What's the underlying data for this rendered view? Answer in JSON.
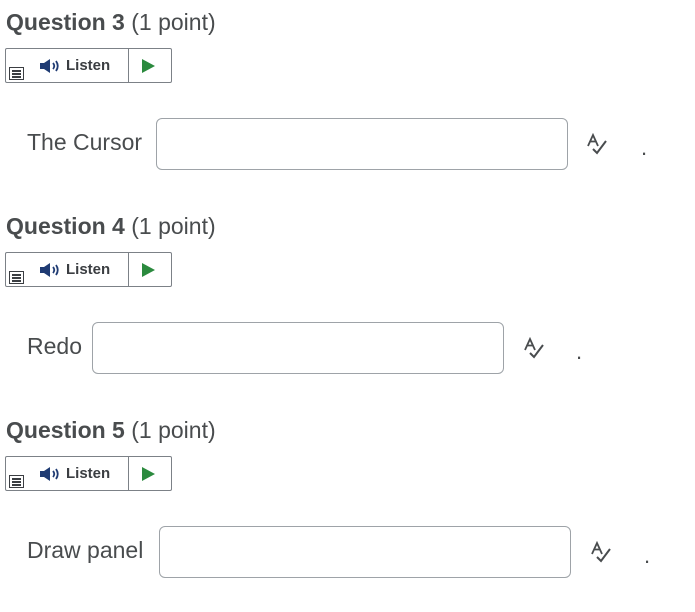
{
  "questions": [
    {
      "number": "Question 3",
      "points": "(1 point)",
      "listen_label": "Listen",
      "prompt": "The Cursor",
      "answer": "",
      "trailing": "."
    },
    {
      "number": "Question 4",
      "points": "(1 point)",
      "listen_label": "Listen",
      "prompt": "Redo",
      "answer": "",
      "trailing": "."
    },
    {
      "number": "Question 5",
      "points": "(1 point)",
      "listen_label": "Listen",
      "prompt": "Draw panel",
      "answer": "",
      "trailing": "."
    }
  ],
  "icons": {
    "menu": "menu-icon",
    "speaker": "speaker-icon",
    "play": "play-icon",
    "spell_check": "spell-check-icon"
  },
  "colors": {
    "text": "#494c4e",
    "border": "#7c8187",
    "input_border": "#9ea3a8",
    "play": "#2b8a3e",
    "speaker": "#1f3b73"
  }
}
